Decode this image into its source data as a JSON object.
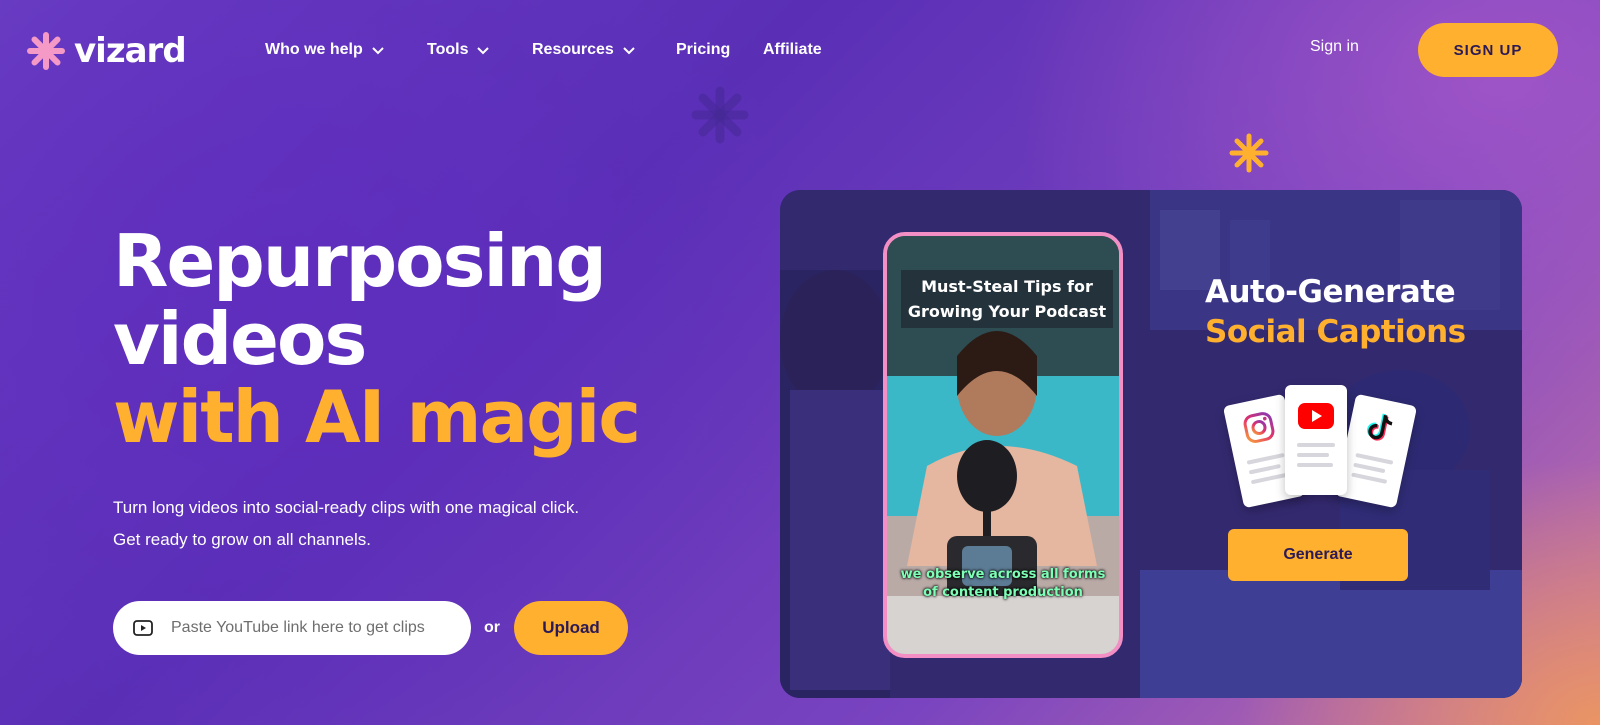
{
  "brand": {
    "name": "vizard"
  },
  "nav": {
    "items": [
      {
        "label": "Who we help",
        "has_dropdown": true
      },
      {
        "label": "Tools",
        "has_dropdown": true
      },
      {
        "label": "Resources",
        "has_dropdown": true
      },
      {
        "label": "Pricing",
        "has_dropdown": false
      },
      {
        "label": "Affiliate",
        "has_dropdown": false
      }
    ],
    "sign_in": "Sign in",
    "sign_up": "SIGN UP"
  },
  "hero": {
    "headline_line1": "Repurposing",
    "headline_line2": "videos",
    "headline_line3": "with AI magic",
    "subtext_line1": "Turn long videos into social-ready clips with one magical click.",
    "subtext_line2": "Get ready to grow on all channels.",
    "input_placeholder": "Paste YouTube link here to get clips",
    "or_label": "or",
    "upload_label": "Upload"
  },
  "demo": {
    "video_title_line1": "Must-Steal Tips for",
    "video_title_line2": "Growing Your Podcast",
    "video_caption_line1": "we observe across all forms",
    "video_caption_line2": "of content production",
    "heading_line1": "Auto-Generate",
    "heading_line2": "Social Captions",
    "generate_label": "Generate",
    "platform_icons": [
      "instagram-icon",
      "youtube-icon",
      "tiktok-icon"
    ]
  },
  "colors": {
    "accent": "#ffb02e",
    "button_text": "#2b1a55",
    "phone_border": "#f48fc6",
    "caption_text": "#7dffb6"
  }
}
